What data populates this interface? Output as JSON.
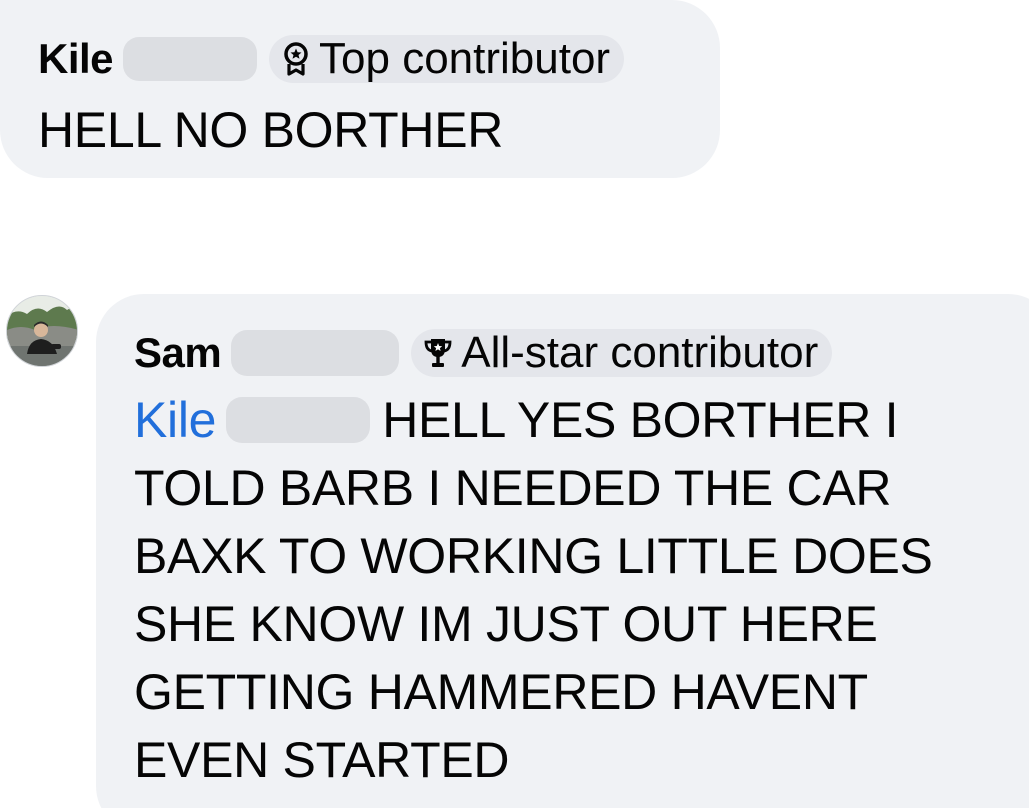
{
  "comments": [
    {
      "author": "Kile",
      "badge": {
        "icon": "badge-ribbon-icon",
        "label": "Top contributor"
      },
      "text": "HELL NO BORTHER"
    },
    {
      "author": "Sam",
      "badge": {
        "icon": "trophy-icon",
        "label": "All-star contributor"
      },
      "mention": "Kile",
      "text": "HELL YES BORTHER I TOLD BARB I NEEDED THE CAR BAXK TO WORKING LITTLE DOES SHE KNOW IM JUST OUT HERE GETTING HAMMERED HAVENT EVEN STARTED"
    }
  ],
  "colors": {
    "bubble_bg": "#f0f2f5",
    "badge_bg": "#e4e6eb",
    "mention": "#216fdb",
    "redaction": "#dcdee2"
  }
}
